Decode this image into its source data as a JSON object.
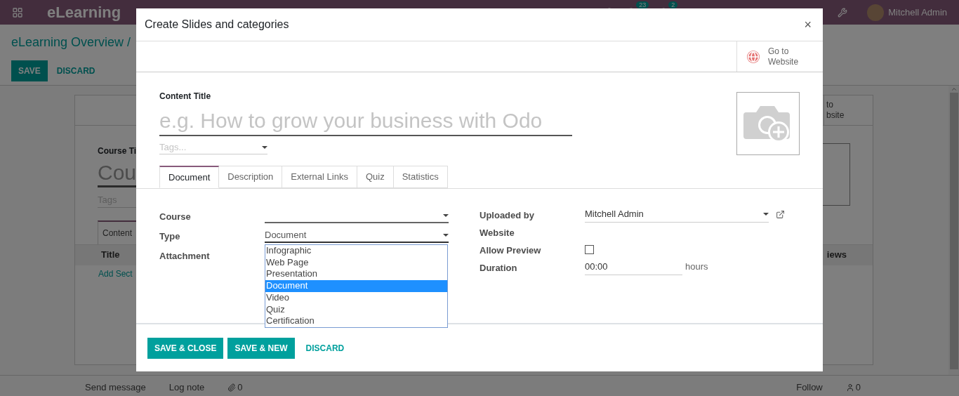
{
  "navbar": {
    "app_name": "eLearning",
    "activity_count": "23",
    "message_count": "2",
    "user": "Mitchell Admin"
  },
  "control_panel": {
    "breadcrumb": "eLearning Overview /",
    "buttons": [
      {
        "label": "SAVE",
        "kind": "primary"
      },
      {
        "label": "DISCARD",
        "kind": "link"
      }
    ]
  },
  "course_form": {
    "button_box_lines": [
      "to",
      "bsite"
    ],
    "title_label": "Course Ti",
    "title_placeholder": "Cou",
    "tags_placeholder": "Tags",
    "tab": "Content",
    "columns": [
      "Title",
      "iews"
    ],
    "add_section": "Add Sect"
  },
  "chatter": {
    "send_message": "Send message",
    "log_note": "Log note",
    "attachments": "0",
    "follow": "Follow",
    "followers": "0"
  },
  "dialog": {
    "title": "Create Slides and categories",
    "close": "×",
    "website_button": "Go to Website",
    "content_title_label": "Content Title",
    "content_title_placeholder": "e.g. How to grow your business with Odo",
    "tags_placeholder": "Tags...",
    "tabs": [
      {
        "label": "Document",
        "selected": true
      },
      {
        "label": "Description",
        "selected": false
      },
      {
        "label": "External Links",
        "selected": false
      },
      {
        "label": "Quiz",
        "selected": false
      },
      {
        "label": "Statistics",
        "selected": false
      }
    ],
    "left_fields": [
      {
        "label": "Course",
        "kind": "select"
      },
      {
        "label": "Type",
        "kind": "select",
        "value": "Document",
        "open": true
      },
      {
        "label": "Attachment",
        "kind": "label"
      }
    ],
    "type_options": [
      {
        "label": "Infographic",
        "selected": false
      },
      {
        "label": "Web Page",
        "selected": false
      },
      {
        "label": "Presentation",
        "selected": false
      },
      {
        "label": "Document",
        "selected": true
      },
      {
        "label": "Video",
        "selected": false
      },
      {
        "label": "Quiz",
        "selected": false
      },
      {
        "label": "Certification",
        "selected": false
      }
    ],
    "right_fields": [
      {
        "label": "Uploaded by",
        "kind": "many2one",
        "value": "Mitchell Admin"
      },
      {
        "label": "Website",
        "kind": "label"
      },
      {
        "label": "Allow Preview",
        "kind": "checkbox",
        "checked": false
      },
      {
        "label": "Duration",
        "kind": "input",
        "value": "00:00",
        "unit": "hours"
      }
    ],
    "footer_buttons": [
      {
        "label": "SAVE & CLOSE",
        "kind": "primary"
      },
      {
        "label": "SAVE & NEW",
        "kind": "primary"
      },
      {
        "label": "DISCARD",
        "kind": "link"
      }
    ]
  }
}
